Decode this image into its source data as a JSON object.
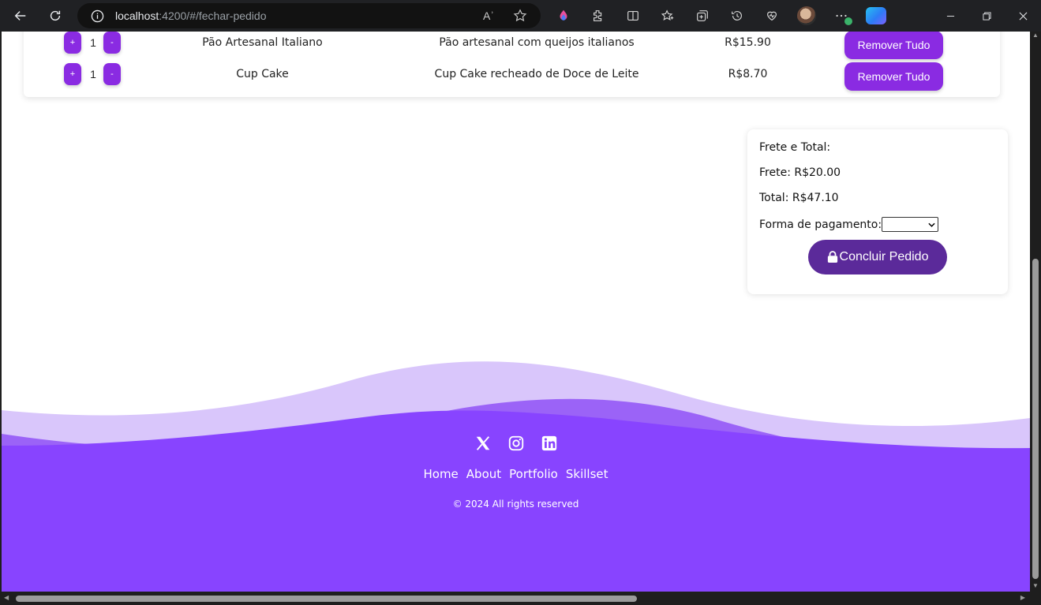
{
  "browser": {
    "url_host": "localhost",
    "url_rest": ":4200/#/fechar-pedido",
    "read_aloud_label": "Aʾ"
  },
  "cart": {
    "items": [
      {
        "qty": "1",
        "plus": "+",
        "minus": "-",
        "name": "Pão Artesanal Italiano",
        "description": "Pão artesanal com queijos italianos",
        "price": "R$15.90",
        "remove_label": "Remover Tudo"
      },
      {
        "qty": "1",
        "plus": "+",
        "minus": "-",
        "name": "Cup Cake",
        "description": "Cup Cake recheado de Doce de Leite",
        "price": "R$8.70",
        "remove_label": "Remover Tudo"
      }
    ]
  },
  "summary": {
    "title": "Frete e Total:",
    "shipping": "Frete: R$20.00",
    "total": "Total: R$47.10",
    "payment_label": "Forma de pagamento:",
    "payment_value": "",
    "conclude_label": "Concluir Pedido"
  },
  "footer": {
    "links": [
      "Home",
      "About",
      "Portfolio",
      "Skillset"
    ],
    "copyright": "© 2024 All rights reserved",
    "social_icons": [
      "x-icon",
      "instagram-icon",
      "linkedin-icon"
    ]
  },
  "colors": {
    "accent": "#8a2be2",
    "conclude_button": "#5b2a9a",
    "footer_main": "#8844ff",
    "footer_mid": "#9b63f7",
    "footer_light": "#d9c6fb"
  }
}
